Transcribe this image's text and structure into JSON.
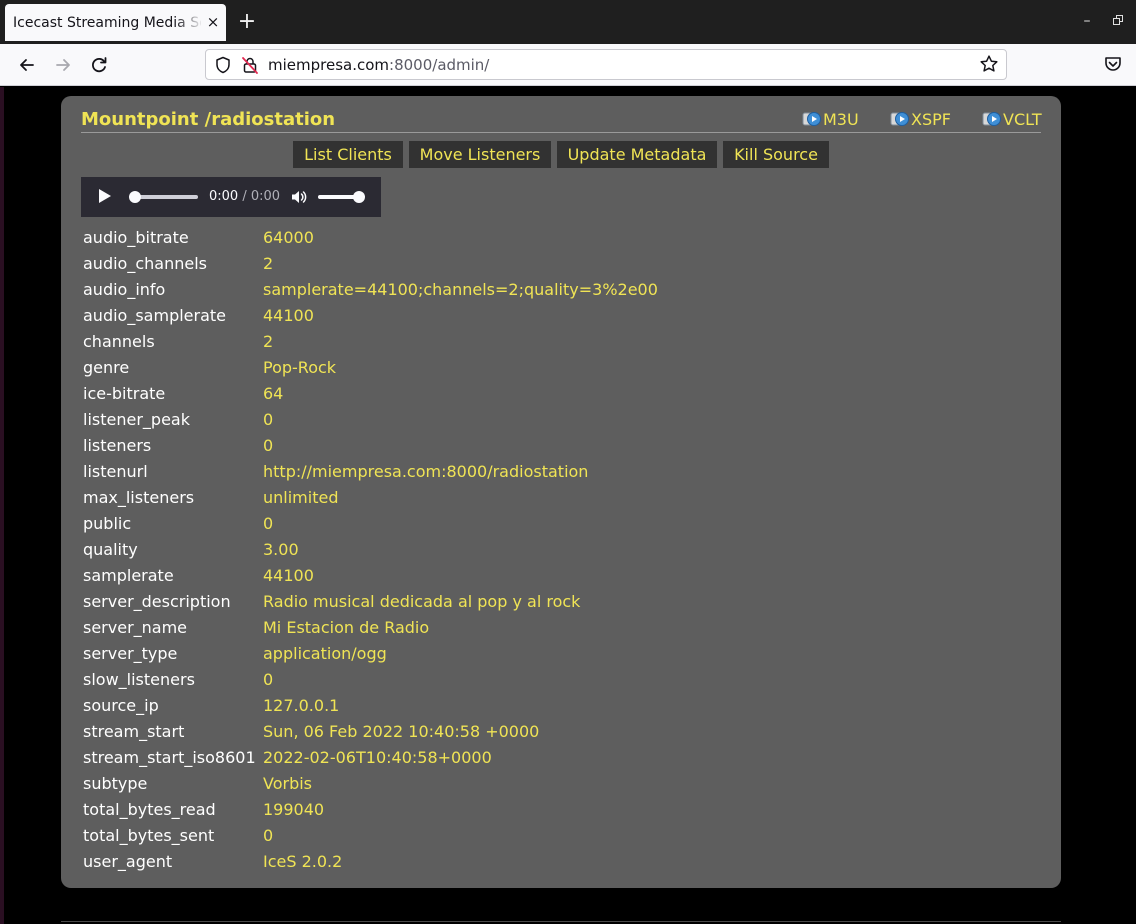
{
  "browser": {
    "tab_title": "Icecast Streaming Media Server",
    "tab_close": "×",
    "new_tab": "+",
    "url_host": "miempresa.com",
    "url_rest": ":8000/admin/",
    "window_min": "–"
  },
  "page": {
    "mount_title": "Mountpoint /radiostation",
    "playlists": [
      {
        "label": "M3U"
      },
      {
        "label": "XSPF"
      },
      {
        "label": "VCLT"
      }
    ],
    "actions": [
      {
        "label": "List Clients"
      },
      {
        "label": "Move Listeners"
      },
      {
        "label": "Update Metadata"
      },
      {
        "label": "Kill Source"
      }
    ],
    "player": {
      "current_time": "0:00",
      "separator": " / ",
      "duration": "0:00",
      "progress": 0.0,
      "volume": 1.0
    },
    "stats": [
      {
        "key": "audio_bitrate",
        "value": "64000"
      },
      {
        "key": "audio_channels",
        "value": "2"
      },
      {
        "key": "audio_info",
        "value": "samplerate=44100;channels=2;quality=3%2e00"
      },
      {
        "key": "audio_samplerate",
        "value": "44100"
      },
      {
        "key": "channels",
        "value": "2"
      },
      {
        "key": "genre",
        "value": "Pop-Rock"
      },
      {
        "key": "ice-bitrate",
        "value": "64"
      },
      {
        "key": "listener_peak",
        "value": "0"
      },
      {
        "key": "listeners",
        "value": "0"
      },
      {
        "key": "listenurl",
        "value": "http://miempresa.com:8000/radiostation"
      },
      {
        "key": "max_listeners",
        "value": "unlimited"
      },
      {
        "key": "public",
        "value": "0"
      },
      {
        "key": "quality",
        "value": "3.00"
      },
      {
        "key": "samplerate",
        "value": "44100"
      },
      {
        "key": "server_description",
        "value": "Radio musical dedicada al pop y al rock"
      },
      {
        "key": "server_name",
        "value": "Mi Estacion de Radio"
      },
      {
        "key": "server_type",
        "value": "application/ogg"
      },
      {
        "key": "slow_listeners",
        "value": "0"
      },
      {
        "key": "source_ip",
        "value": "127.0.0.1"
      },
      {
        "key": "stream_start",
        "value": "Sun, 06 Feb 2022 10:40:58 +0000"
      },
      {
        "key": "stream_start_iso8601",
        "value": "2022-02-06T10:40:58+0000"
      },
      {
        "key": "subtype",
        "value": "Vorbis"
      },
      {
        "key": "total_bytes_read",
        "value": "199040"
      },
      {
        "key": "total_bytes_sent",
        "value": "0"
      },
      {
        "key": "user_agent",
        "value": "IceS 2.0.2"
      }
    ]
  },
  "colors": {
    "accent_yellow": "#f0e455",
    "panel_gray": "#5e5e5e",
    "button_dark": "#323232",
    "page_background": "#000000"
  },
  "icons": {
    "back": "arrow-left-icon",
    "forward": "arrow-right-icon",
    "reload": "reload-icon",
    "shield": "shield-icon",
    "insecure": "insecure-lock-icon",
    "bookmark": "star-icon",
    "pocket": "pocket-icon",
    "playlist": "playlist-icon",
    "play": "play-icon",
    "volume": "volume-icon"
  }
}
